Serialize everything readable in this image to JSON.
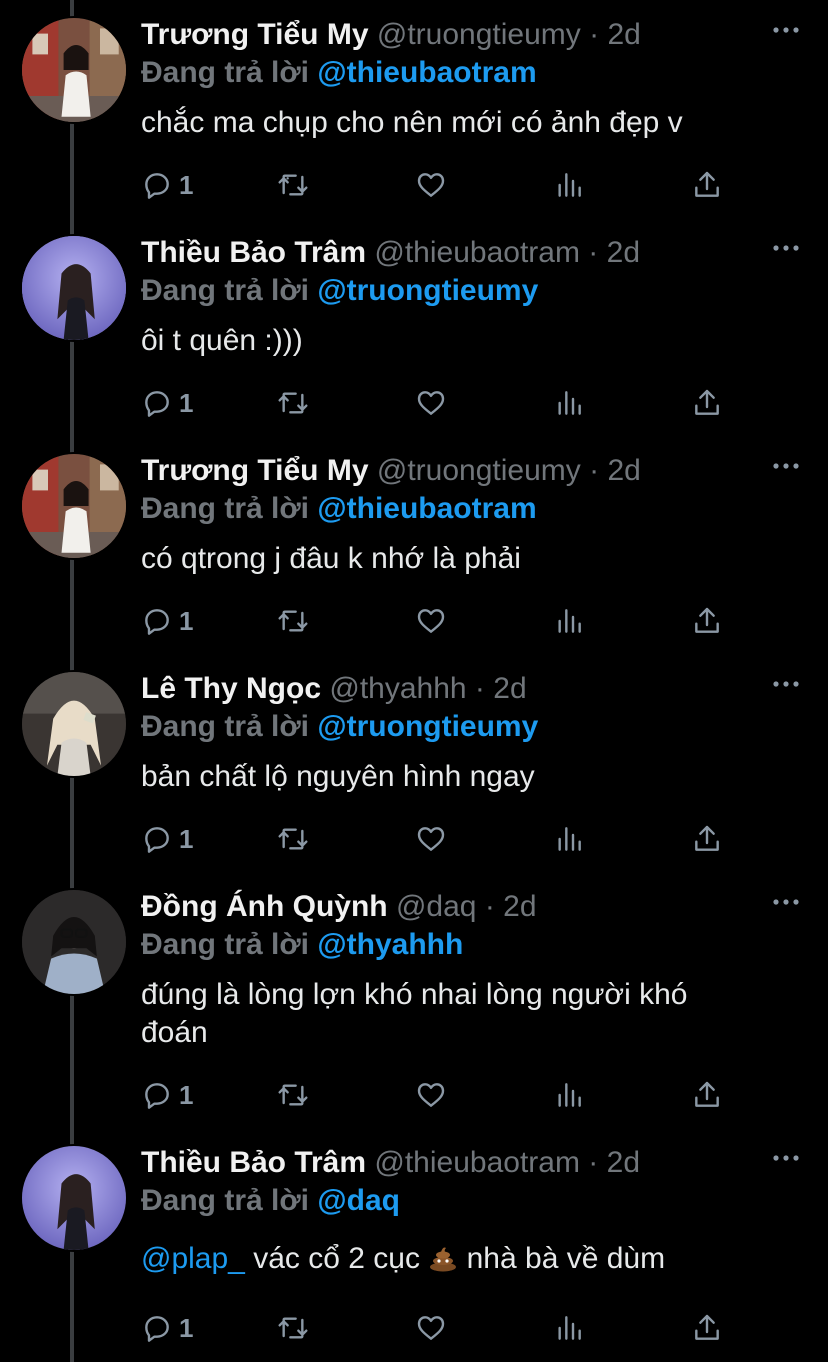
{
  "reply_prefix": "Đang trả lời",
  "dot": "·",
  "tweets": [
    {
      "name": "Trương Tiểu My",
      "handle": "@truongtieumy",
      "time": "2d",
      "reply_to": "@thieubaotram",
      "text": "chắc ma chụp cho nên mới có ảnh đẹp v",
      "text_line2": "",
      "replies": "1",
      "avatar": "avatar-truongtieumy"
    },
    {
      "name": "Thiều Bảo Trâm",
      "handle": "@thieubaotram",
      "time": "2d",
      "reply_to": "@truongtieumy",
      "text": "ôi t quên :)))",
      "text_line2": "",
      "replies": "1",
      "avatar": "avatar-thieubaotram"
    },
    {
      "name": "Trương Tiểu My",
      "handle": "@truongtieumy",
      "time": "2d",
      "reply_to": "@thieubaotram",
      "text": "có qtrong j đâu k nhớ là phải",
      "text_line2": "",
      "replies": "1",
      "avatar": "avatar-truongtieumy"
    },
    {
      "name": "Lê Thy Ngọc",
      "handle": "@thyahhh",
      "time": "2d",
      "reply_to": "@truongtieumy",
      "text": "bản chất lộ nguyên hình ngay",
      "text_line2": "",
      "replies": "1",
      "avatar": "avatar-thyahhh"
    },
    {
      "name": "Đồng Ánh Quỳnh",
      "handle": "@daq",
      "time": "2d",
      "reply_to": "@thyahhh",
      "text": "đúng là lòng lợn khó nhai lòng người khó",
      "text_line2": "đoán",
      "replies": "1",
      "avatar": "avatar-daq"
    },
    {
      "name": "Thiều Bảo Trâm",
      "handle": "@thieubaotram",
      "time": "2d",
      "reply_to": "@daq",
      "text_mention": "@plap_",
      "text": " vác cổ 2 cục ",
      "text_after_emoji": " nhà bà về dùm",
      "emoji": "poop-emoji",
      "replies": "1",
      "avatar": "avatar-thieubaotram"
    }
  ],
  "icons": {
    "reply": "reply-icon",
    "retweet": "retweet-icon",
    "like": "heart-icon",
    "views": "analytics-icon",
    "share": "share-icon",
    "more": "more-icon"
  },
  "colors": {
    "background": "#000000",
    "name": "#f1f1f1",
    "muted": "#71767b",
    "mention": "#1d9bf0",
    "icon": "#8b98a5"
  }
}
